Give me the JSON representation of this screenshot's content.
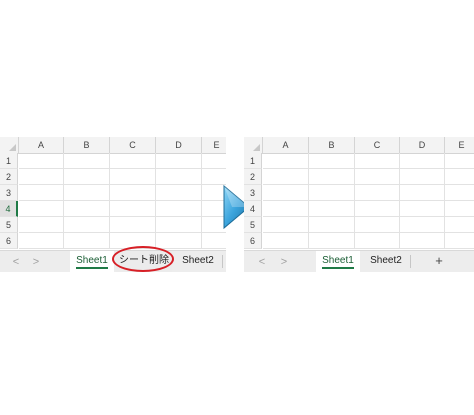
{
  "columns": [
    "A",
    "B",
    "C",
    "D",
    "E"
  ],
  "rows": [
    "1",
    "2",
    "3",
    "4",
    "5",
    "6"
  ],
  "selected_row": "4",
  "colors": {
    "accent_green": "#1f7a46",
    "highlight_red": "#d71f26",
    "arrow_blue": "#3aa3dc"
  },
  "before": {
    "nav": {
      "prev": "<",
      "next": ">"
    },
    "tabs": {
      "sheet1": "Sheet1",
      "sheet2": "Sheet2"
    },
    "context_action": "シート削除",
    "active_tab": "Sheet1"
  },
  "transition_icon": "play-arrow-icon",
  "after": {
    "nav": {
      "prev": "<",
      "next": ">"
    },
    "tabs": {
      "sheet1": "Sheet1",
      "sheet2": "Sheet2"
    },
    "add_sheet": "+",
    "active_tab": "Sheet1"
  }
}
